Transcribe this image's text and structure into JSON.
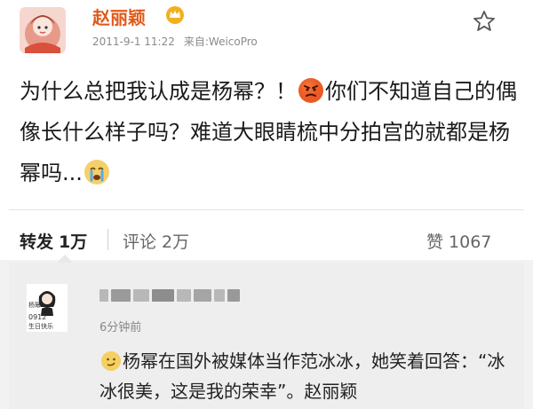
{
  "post": {
    "username": "赵丽颖",
    "timestamp": "2011-9-1 11:22",
    "source_prefix": "来自:",
    "source": "WeicoPro",
    "text_part1": "为什么总把我认成是杨幂？！",
    "text_part2": "你们不知道自己的偶像长什么样子吗？难道大眼睛梳中分拍宫的就都是杨幂吗...",
    "emoji_1": "angry-face-icon",
    "emoji_2": "crying-face-icon"
  },
  "actions": {
    "repost_label": "转发",
    "repost_count": "1万",
    "comment_label": "评论",
    "comment_count": "2万",
    "like_label": "赞",
    "like_count": "1067"
  },
  "comment": {
    "avatar_text_1": "杨幂",
    "avatar_text_2": "0912",
    "avatar_text_3": "生日快乐",
    "time": "6分钟前",
    "text": "杨幂在国外被媒体当作范冰冰，她笑着回答：“冰冰很美，这是我的荣幸”。赵丽颖",
    "emoji": "smirk-face-icon"
  },
  "colors": {
    "username": "#e05a1a",
    "background": "#f2f2f2",
    "comment_bg": "#eeeeee"
  }
}
